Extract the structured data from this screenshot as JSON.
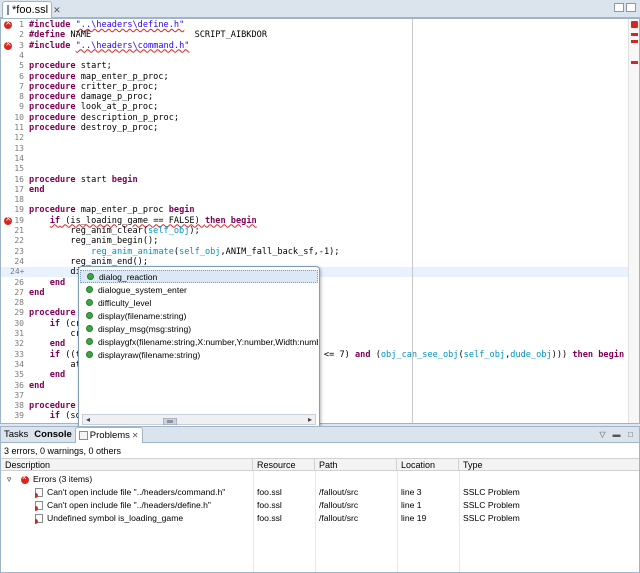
{
  "editor_tab": {
    "label": "*foo.ssl"
  },
  "code_lines": [
    {
      "n": "1",
      "err": true,
      "html": "<span class='kw'>#include</span> <span class='str sq'>\"..\\headers\\define.h\"</span>"
    },
    {
      "n": "2",
      "err": false,
      "html": "<span class='kw'>#define</span> NAME                    SCRIPT_AIBKDOR"
    },
    {
      "n": "3",
      "err": true,
      "html": "<span class='kw'>#include</span> <span class='str sq'>\"..\\headers\\command.h\"</span>"
    },
    {
      "n": "4",
      "err": false,
      "html": ""
    },
    {
      "n": "5",
      "err": false,
      "html": "<span class='kw'>procedure</span> start;"
    },
    {
      "n": "6",
      "err": false,
      "html": "<span class='kw'>procedure</span> map_enter_p_proc;"
    },
    {
      "n": "7",
      "err": false,
      "html": "<span class='kw'>procedure</span> critter_p_proc;"
    },
    {
      "n": "8",
      "err": false,
      "html": "<span class='kw'>procedure</span> damage_p_proc;"
    },
    {
      "n": "9",
      "err": false,
      "html": "<span class='kw'>procedure</span> look_at_p_proc;"
    },
    {
      "n": "10",
      "err": false,
      "html": "<span class='kw'>procedure</span> description_p_proc;"
    },
    {
      "n": "11",
      "err": false,
      "html": "<span class='kw'>procedure</span> destroy_p_proc;"
    },
    {
      "n": "12",
      "err": false,
      "html": ""
    },
    {
      "n": "13",
      "err": false,
      "html": ""
    },
    {
      "n": "14",
      "err": false,
      "html": ""
    },
    {
      "n": "15",
      "err": false,
      "html": ""
    },
    {
      "n": "16",
      "err": false,
      "html": "<span class='kw'>procedure</span> start <span class='kw'>begin</span>"
    },
    {
      "n": "17",
      "err": false,
      "html": "<span class='kw'>end</span>"
    },
    {
      "n": "18",
      "err": false,
      "html": ""
    },
    {
      "n": "19",
      "err": false,
      "html": "<span class='kw'>procedure</span> map_enter_p_proc <span class='kw'>begin</span>"
    },
    {
      "n": "19",
      "err": true,
      "html": "    <span class='kw sq'>if</span><span class='sq'> (is_loading_game == FALSE) </span><span class='kw sq'>then begin</span>"
    },
    {
      "n": "21",
      "err": false,
      "html": "        reg_anim_clear(<span class='cyan'>self_obj</span>);"
    },
    {
      "n": "22",
      "err": false,
      "html": "        reg_anim_begin();"
    },
    {
      "n": "23",
      "err": false,
      "html": "            <span class='cyan'>reg_anim_animate</span>(<span class='cyan'>self_obj</span>,ANIM_fall_back_sf,-1);"
    },
    {
      "n": "24",
      "err": false,
      "html": "        reg_anim_end();"
    },
    {
      "n": "24+",
      "err": false,
      "html": "        di",
      "cur": true
    },
    {
      "n": "26",
      "err": false,
      "html": "    <span class='kw'>end</span>"
    },
    {
      "n": "27",
      "err": false,
      "html": "<span class='kw'>end</span>"
    },
    {
      "n": "28",
      "err": false,
      "html": ""
    },
    {
      "n": "29",
      "err": false,
      "html": "<span class='kw'>procedure</span>"
    },
    {
      "n": "30",
      "err": false,
      "html": "    <span class='kw'>if</span> (cri"
    },
    {
      "n": "31",
      "err": false,
      "html": "        cr"
    },
    {
      "n": "32",
      "err": false,
      "html": "    <span class='kw'>end</span>"
    },
    {
      "n": "33",
      "err": false,
      "html": "    <span class='kw'>if</span> ((ti                                              <= 7) <span class='kw'>and</span> (<span class='cyan'>obj_can_see_obj</span>(<span class='cyan'>self_obj</span>,<span class='cyan'>dude_obj</span>))) <span class='kw'>then begin</span>"
    },
    {
      "n": "34",
      "err": false,
      "html": "        at"
    },
    {
      "n": "35",
      "err": false,
      "html": "    <span class='kw'>end</span>"
    },
    {
      "n": "36",
      "err": false,
      "html": "<span class='kw'>end</span>"
    },
    {
      "n": "37",
      "err": false,
      "html": ""
    },
    {
      "n": "38",
      "err": false,
      "html": "<span class='kw'>procedure</span>"
    },
    {
      "n": "39",
      "err": false,
      "html": "    <span class='kw'>if</span> (sou"
    }
  ],
  "completion": {
    "items": [
      "dialog_reaction",
      "dialogue_system_enter",
      "difficulty_level",
      "display(filename:string)",
      "display_msg(msg:string)",
      "displaygfx(filename:string,X:number,Y:number,Width:number",
      "displayraw(filename:string)"
    ],
    "selected": 0
  },
  "panel": {
    "tabs": [
      {
        "label": "Tasks"
      },
      {
        "label": "Console"
      },
      {
        "label": "Problems"
      }
    ],
    "summary": "3 errors, 0 warnings, 0 others",
    "columns": [
      "Description",
      "Resource",
      "Path",
      "Location",
      "Type"
    ],
    "group": "Errors (3 items)",
    "rows": [
      {
        "description": "Can't open include file \"../headers/command.h\"",
        "resource": "foo.ssl",
        "path": "/fallout/src",
        "location": "line 3",
        "type": "SSLC Problem"
      },
      {
        "description": "Can't open include file \"../headers/define.h\"",
        "resource": "foo.ssl",
        "path": "/fallout/src",
        "location": "line 1",
        "type": "SSLC Problem"
      },
      {
        "description": "Undefined symbol is_loading_game",
        "resource": "foo.ssl",
        "path": "/fallout/src",
        "location": "line 19",
        "type": "SSLC Problem"
      }
    ]
  }
}
